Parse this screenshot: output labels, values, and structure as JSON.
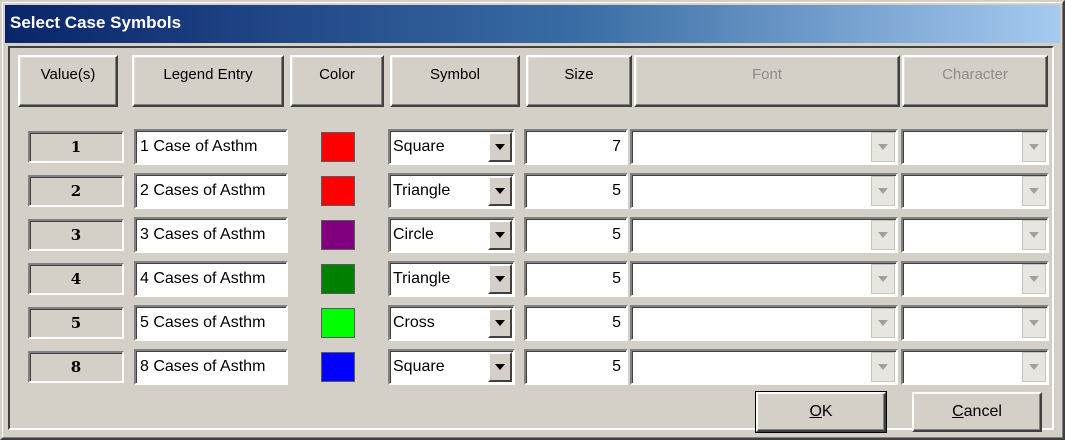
{
  "window": {
    "title": "Select Case Symbols"
  },
  "headers": {
    "values": "Value(s)",
    "legend": "Legend Entry",
    "color": "Color",
    "symbol": "Symbol",
    "size": "Size",
    "font": "Font",
    "character": "Character"
  },
  "rows": [
    {
      "value": "1",
      "legend": "1 Case of Asthm",
      "color": "#ff0000",
      "symbol": "Square",
      "size": "7",
      "font": "",
      "character": ""
    },
    {
      "value": "2",
      "legend": "2 Cases of Asthm",
      "color": "#ff0000",
      "symbol": "Triangle",
      "size": "5",
      "font": "",
      "character": ""
    },
    {
      "value": "3",
      "legend": "3 Cases of Asthm",
      "color": "#800080",
      "symbol": "Circle",
      "size": "5",
      "font": "",
      "character": ""
    },
    {
      "value": "4",
      "legend": "4 Cases of Asthm",
      "color": "#008000",
      "symbol": "Triangle",
      "size": "5",
      "font": "",
      "character": ""
    },
    {
      "value": "5",
      "legend": "5 Cases of Asthm",
      "color": "#00ff00",
      "symbol": "Cross",
      "size": "5",
      "font": "",
      "character": ""
    },
    {
      "value": "8",
      "legend": "8 Cases of Asthm",
      "color": "#0000ff",
      "symbol": "Square",
      "size": "5",
      "font": "",
      "character": ""
    }
  ],
  "buttons": {
    "ok": {
      "mnemonic": "O",
      "rest": "K"
    },
    "cancel": {
      "mnemonic": "C",
      "rest": "ancel"
    }
  },
  "icons": {
    "dropdown": "chevron-down-icon"
  }
}
